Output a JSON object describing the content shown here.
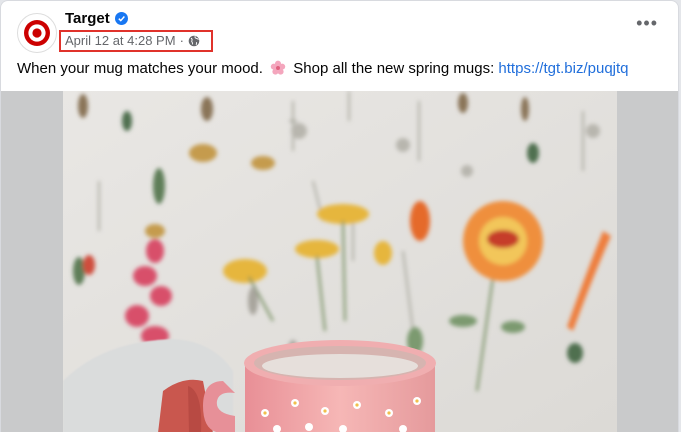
{
  "post": {
    "page_name": "Target",
    "timestamp": "April 12 at 4:28 PM",
    "separator": "·",
    "audience_icon": "globe-icon",
    "more_icon": "more-options-icon",
    "text_before": "When your mug matches your mood.",
    "text_after": "Shop all the new spring mugs:",
    "emoji_icon": "cherry-blossom-icon",
    "link": "https://tgt.biz/puqjtq"
  },
  "colors": {
    "brand_red": "#cc0000",
    "verified_blue": "#1877f2",
    "link_blue": "#216fdb",
    "highlight_red": "#e0322b",
    "meta_gray": "#65676b"
  }
}
